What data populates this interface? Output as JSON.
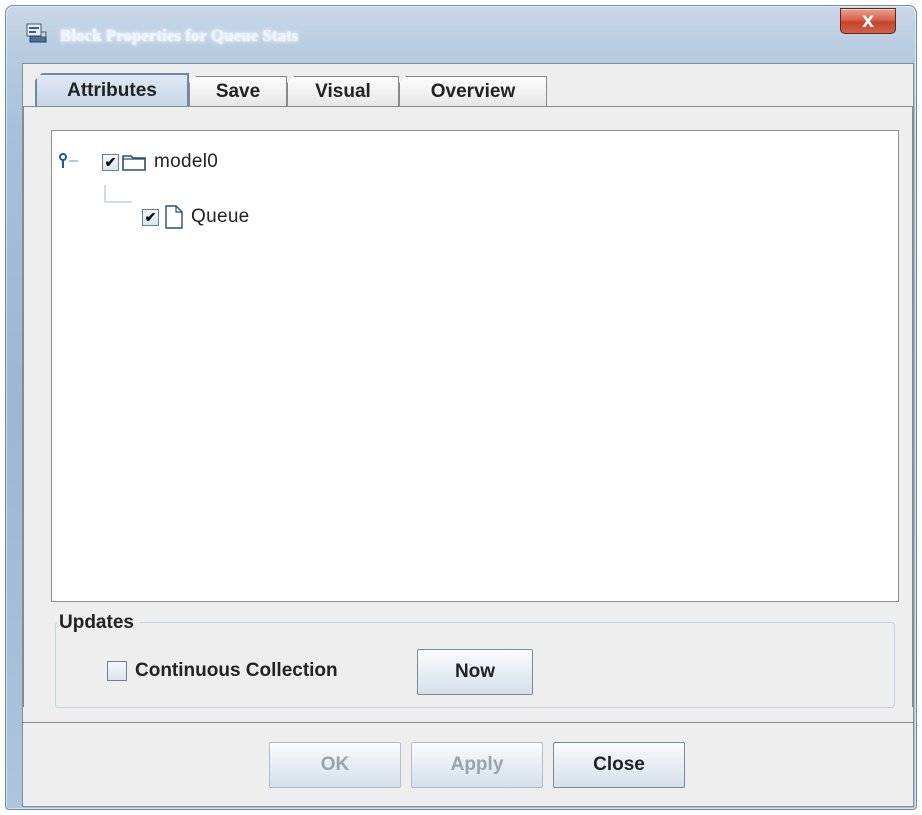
{
  "window": {
    "title": "Block Properties for Queue Stats",
    "close_glyph": "X"
  },
  "tabs": [
    {
      "label": "Attributes",
      "selected": true
    },
    {
      "label": "Save",
      "selected": false
    },
    {
      "label": "Visual",
      "selected": false
    },
    {
      "label": "Overview",
      "selected": false
    }
  ],
  "tree": {
    "root": {
      "label": "model0",
      "checked": true,
      "icon": "folder-icon"
    },
    "children": [
      {
        "label": "Queue",
        "checked": true,
        "icon": "file-icon"
      }
    ]
  },
  "updates": {
    "group_title": "Updates",
    "continuous_label": "Continuous Collection",
    "continuous_checked": false,
    "now_label": "Now"
  },
  "footer": {
    "ok_label": "OK",
    "ok_enabled": false,
    "apply_label": "Apply",
    "apply_enabled": false,
    "close_label": "Close",
    "close_enabled": true
  },
  "check_glyph": "✔"
}
